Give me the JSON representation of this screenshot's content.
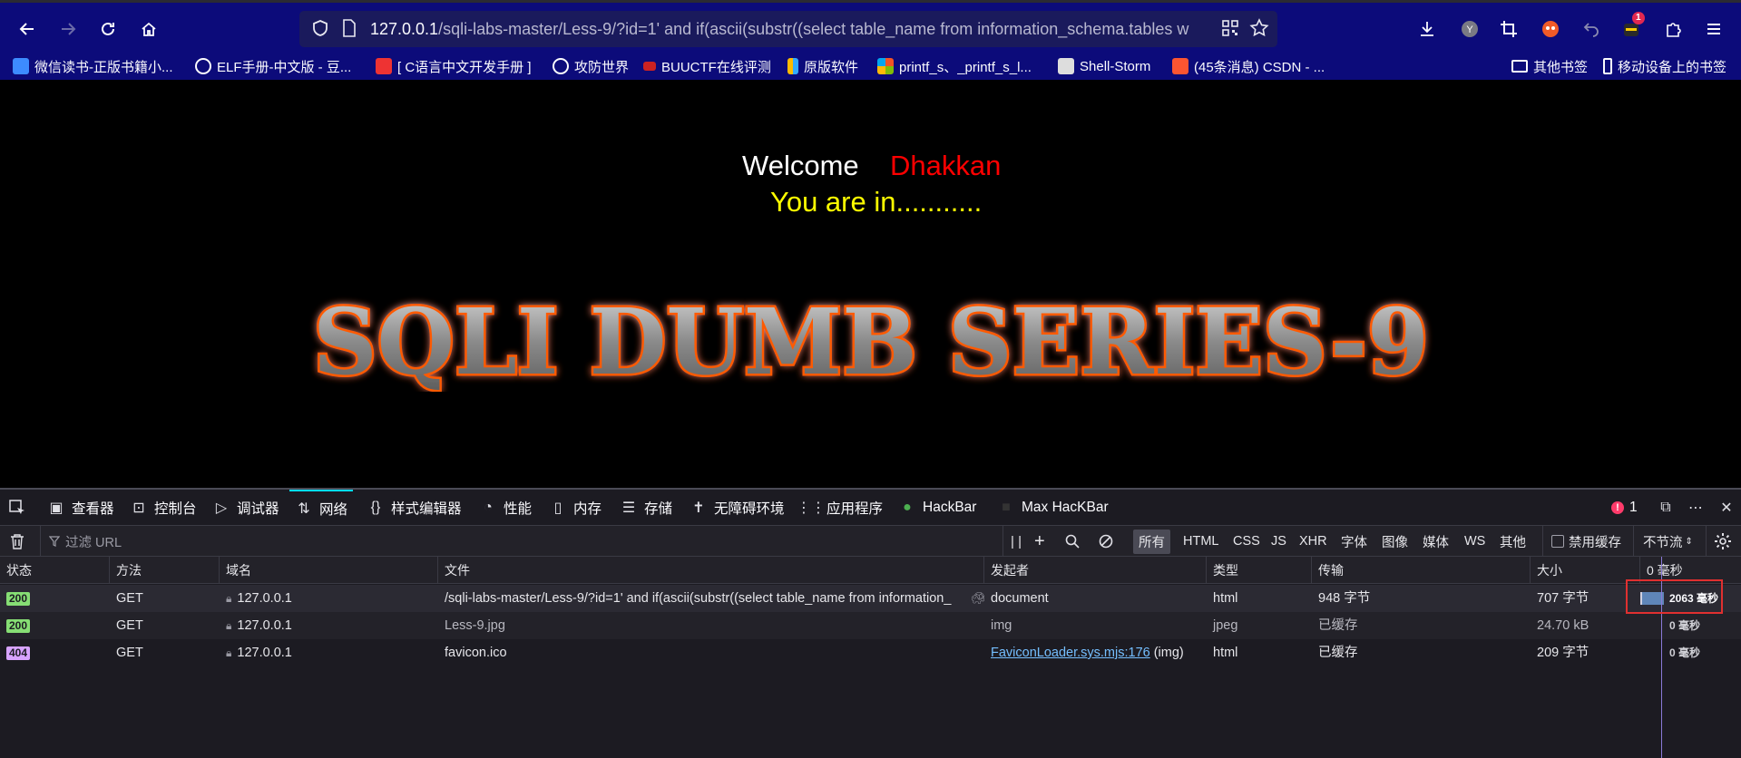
{
  "browser": {
    "url_host": "127.0.0.1",
    "url_rest": "/sqli-labs-master/Less-9/?id=1' and if(ascii(substr((select table_name from information_schema.tables w",
    "notification_count": "1"
  },
  "bookmarks": [
    {
      "label": "微信读书-正版书籍小...",
      "icon_color": "#3d8bff",
      "icon": "book-icon"
    },
    {
      "label": "ELF手册-中文版 - 豆...",
      "icon_color": "#fbfbfe",
      "icon": "globe-icon"
    },
    {
      "label": "[ C语言中文开发手册 ]",
      "icon_color": "#e33",
      "icon": "php-icon"
    },
    {
      "label": "攻防世界",
      "icon_color": "#fbfbfe",
      "icon": "globe-icon"
    },
    {
      "label": "BUUCTF在线评测",
      "icon_color": "#e33",
      "icon": "buuctf-icon"
    },
    {
      "label": "原版软件",
      "icon_color": "#fb0",
      "icon": "msdn-icon"
    },
    {
      "label": "printf_s、_printf_s_l...",
      "icon_color": "#4caf50",
      "icon": "windows-icon"
    },
    {
      "label": "Shell-Storm",
      "icon_color": "#ddd",
      "icon": "shellstorm-icon"
    },
    {
      "label": "(45条消息) CSDN - ...",
      "icon_color": "#fc5531",
      "icon": "csdn-icon"
    }
  ],
  "bookmarks_right": [
    {
      "label": "其他书签",
      "icon": "folder-icon"
    },
    {
      "label": "移动设备上的书签",
      "icon": "mobile-icon"
    }
  ],
  "page": {
    "welcome": "Welcome",
    "name": "Dhakkan",
    "status": "You are in...........",
    "banner": "SQLI DUMB SERIES-9"
  },
  "devtools": {
    "tabs": [
      {
        "label": "查看器",
        "icon": "inspector-icon"
      },
      {
        "label": "控制台",
        "icon": "console-icon"
      },
      {
        "label": "调试器",
        "icon": "debugger-icon"
      },
      {
        "label": "网络",
        "icon": "network-icon"
      },
      {
        "label": "样式编辑器",
        "icon": "style-editor-icon"
      },
      {
        "label": "性能",
        "icon": "performance-icon"
      },
      {
        "label": "内存",
        "icon": "memory-icon"
      },
      {
        "label": "存储",
        "icon": "storage-icon"
      },
      {
        "label": "无障碍环境",
        "icon": "accessibility-icon"
      },
      {
        "label": "应用程序",
        "icon": "application-icon"
      },
      {
        "label": "HackBar",
        "icon": "hackbar-icon"
      },
      {
        "label": "Max HacKBar",
        "icon": "max-hackbar-icon"
      }
    ],
    "error_count": "1",
    "filter_placeholder": "过滤 URL",
    "type_filters": [
      "所有",
      "HTML",
      "CSS",
      "JS",
      "XHR",
      "字体",
      "图像",
      "媒体",
      "WS",
      "其他"
    ],
    "disable_cache_label": "禁用缓存",
    "throttle_label": "不节流",
    "columns": [
      "状态",
      "方法",
      "域名",
      "文件",
      "发起者",
      "类型",
      "传输",
      "大小",
      "0 毫秒"
    ],
    "rows": [
      {
        "status": "200",
        "method": "GET",
        "domain": "127.0.0.1",
        "file": "/sqli-labs-master/Less-9/?id=1' and if(ascii(substr((select table_name from information_",
        "initiator": "document",
        "initiator_link": "",
        "initiator_suffix": "",
        "type": "html",
        "transfer": "948 字节",
        "size": "707 字节",
        "time": "2063 毫秒"
      },
      {
        "status": "200",
        "method": "GET",
        "domain": "127.0.0.1",
        "file": "Less-9.jpg",
        "initiator": "img",
        "initiator_link": "",
        "initiator_suffix": "",
        "type": "jpeg",
        "transfer": "已缓存",
        "size": "24.70 kB",
        "time": "0 毫秒"
      },
      {
        "status": "404",
        "method": "GET",
        "domain": "127.0.0.1",
        "file": "favicon.ico",
        "initiator": "",
        "initiator_link": "FaviconLoader.sys.mjs:176",
        "initiator_suffix": " (img)",
        "type": "html",
        "transfer": "已缓存",
        "size": "209 字节",
        "time": "0 毫秒"
      }
    ]
  },
  "colors": {
    "nav_bg": "#0c0b7a",
    "status_200": "#86de74",
    "status_404": "#d7a3ff",
    "highlight_box": "#e03030"
  }
}
